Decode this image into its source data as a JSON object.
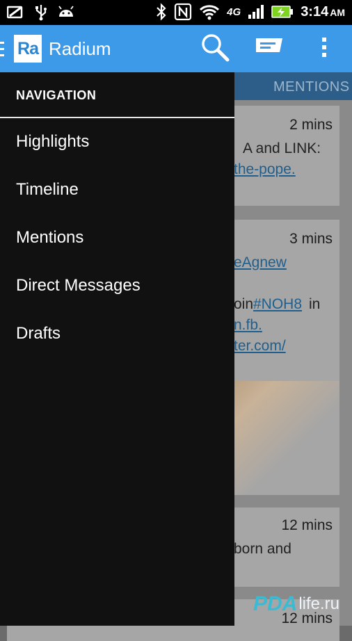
{
  "status_bar": {
    "time": "3:14",
    "ampm": "AM",
    "network": "4G",
    "left_icons": [
      "screen-icon",
      "usb-icon",
      "android-icon"
    ],
    "right_icons": [
      "bluetooth-icon",
      "nfc-icon",
      "wifi-icon",
      "lte-icon",
      "signal-icon",
      "battery-charging-icon"
    ]
  },
  "action_bar": {
    "logo": "Ra",
    "title": "Radium",
    "color": "#3d9ae8",
    "actions": [
      "search-icon",
      "compose-icon",
      "overflow-menu-icon"
    ]
  },
  "background": {
    "tab": "MENTIONS",
    "cards": [
      {
        "time": "2 mins",
        "lines": [
          "A and LINK:"
        ],
        "links": [
          "the-pope."
        ]
      },
      {
        "time": "3 mins",
        "links": [
          "eAgnew",
          "n.fb.",
          "ter.com/"
        ],
        "lines": [
          "oin"
        ],
        "hashtag": "#NOH8",
        "after_hashtag": "in"
      },
      {
        "time": "12 mins",
        "lines": [
          "born and"
        ]
      },
      {
        "time": "12 mins"
      }
    ],
    "watermark_logo": "PDA",
    "watermark_text": "life.ru"
  },
  "drawer": {
    "header": "NAVIGATION",
    "items": [
      {
        "label": "Highlights"
      },
      {
        "label": "Timeline"
      },
      {
        "label": "Mentions"
      },
      {
        "label": "Direct Messages"
      },
      {
        "label": "Drafts"
      }
    ]
  }
}
